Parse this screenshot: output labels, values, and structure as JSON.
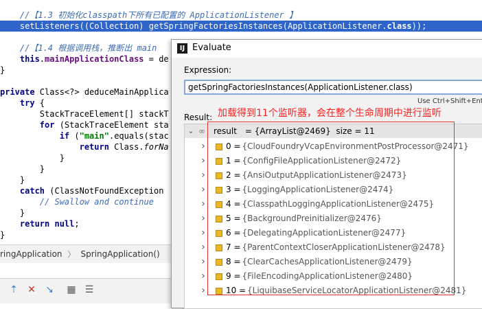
{
  "editor": {
    "lines": [
      {
        "parts": [
          {
            "c": "cm",
            "t": "    //【1.3 初始化classpath下所有已配置的 ApplicationListener 】"
          }
        ]
      },
      {
        "hl": true,
        "parts": [
          {
            "c": "pn",
            "t": "    setListeners((Collection) getSpringFactoriesInstances(ApplicationListener."
          },
          {
            "c": "kw",
            "t": "class"
          },
          {
            "c": "pn",
            "t": "));"
          }
        ]
      },
      {
        "parts": []
      },
      {
        "parts": [
          {
            "c": "cm",
            "t": "    //【1.4 根据调用栈，推断出 main"
          }
        ]
      },
      {
        "parts": [
          {
            "c": "kw",
            "t": "    this"
          },
          {
            "c": "pn",
            "t": "."
          },
          {
            "c": "fd",
            "t": "mainApplicationClass"
          },
          {
            "c": "pn",
            "t": " = de"
          }
        ]
      },
      {
        "parts": [
          {
            "c": "pn",
            "t": "}"
          }
        ]
      },
      {
        "parts": []
      },
      {
        "parts": [
          {
            "c": "kw",
            "t": "private"
          },
          {
            "c": "pn",
            "t": " Class<?> deduceMainApplica"
          }
        ]
      },
      {
        "parts": [
          {
            "c": "kw",
            "t": "    try"
          },
          {
            "c": "pn",
            "t": " {"
          }
        ]
      },
      {
        "parts": [
          {
            "c": "pn",
            "t": "        StackTraceElement[] stackT"
          }
        ]
      },
      {
        "parts": [
          {
            "c": "kw",
            "t": "        for"
          },
          {
            "c": "pn",
            "t": " (StackTraceElement sta"
          }
        ]
      },
      {
        "parts": [
          {
            "c": "kw",
            "t": "            if"
          },
          {
            "c": "pn",
            "t": " ("
          },
          {
            "c": "st",
            "t": "\"main\""
          },
          {
            "c": "pn",
            "t": ".equals(stac"
          }
        ]
      },
      {
        "parts": [
          {
            "c": "kw",
            "t": "                return"
          },
          {
            "c": "pn",
            "t": " Class."
          },
          {
            "c": "it",
            "t": "forNa"
          }
        ]
      },
      {
        "parts": [
          {
            "c": "pn",
            "t": "            }"
          }
        ]
      },
      {
        "parts": [
          {
            "c": "pn",
            "t": "        }"
          }
        ]
      },
      {
        "parts": [
          {
            "c": "pn",
            "t": "    }"
          }
        ]
      },
      {
        "parts": [
          {
            "c": "kw",
            "t": "    catch"
          },
          {
            "c": "pn",
            "t": " (ClassNotFoundException"
          }
        ]
      },
      {
        "parts": [
          {
            "c": "cm",
            "t": "        // Swallow and continue"
          }
        ]
      },
      {
        "parts": [
          {
            "c": "pn",
            "t": "    }"
          }
        ]
      },
      {
        "parts": [
          {
            "c": "kw",
            "t": "    return null"
          },
          {
            "c": "pn",
            "t": ";"
          }
        ]
      },
      {
        "parts": [
          {
            "c": "pn",
            "t": "}"
          }
        ]
      }
    ]
  },
  "breadcrumb": {
    "first": "ringApplication",
    "separator": "〉",
    "second": "SpringApplication()"
  },
  "dialog": {
    "title": "Evaluate",
    "app_icon_letter": "IJ",
    "expression_label": "Expression:",
    "expression_value": "getSpringFactoriesInstances(ApplicationListener.class)",
    "hint": "Use Ctrl+Shift+Ent",
    "result_label": "Result:",
    "result_root": {
      "icon": "∞",
      "name": "result",
      "value": " = {ArrayList@2469}  size = 11"
    },
    "result_items": [
      {
        "index": "0",
        "value": "{CloudFoundryVcapEnvironmentPostProcessor@2471}"
      },
      {
        "index": "1",
        "value": "{ConfigFileApplicationListener@2472}"
      },
      {
        "index": "2",
        "value": "{AnsiOutputApplicationListener@2473}"
      },
      {
        "index": "3",
        "value": "{LoggingApplicationListener@2474}"
      },
      {
        "index": "4",
        "value": "{ClasspathLoggingApplicationListener@2475}"
      },
      {
        "index": "5",
        "value": "{BackgroundPreinitializer@2476}"
      },
      {
        "index": "6",
        "value": "{DelegatingApplicationListener@2477}"
      },
      {
        "index": "7",
        "value": "{ParentContextCloserApplicationListener@2478}"
      },
      {
        "index": "8",
        "value": "{ClearCachesApplicationListener@2479}"
      },
      {
        "index": "9",
        "value": "{FileEncodingApplicationListener@2480}"
      },
      {
        "index": "10",
        "value": "{LiquibaseServiceLocatorApplicationListener@2481}"
      }
    ]
  },
  "annotation": "加载得到11个监听器，会在整个生命周期中进行监听",
  "colors": {
    "selection": "#2f65ca",
    "annotation": "#ff2020",
    "item_icon": "#e8b923"
  }
}
